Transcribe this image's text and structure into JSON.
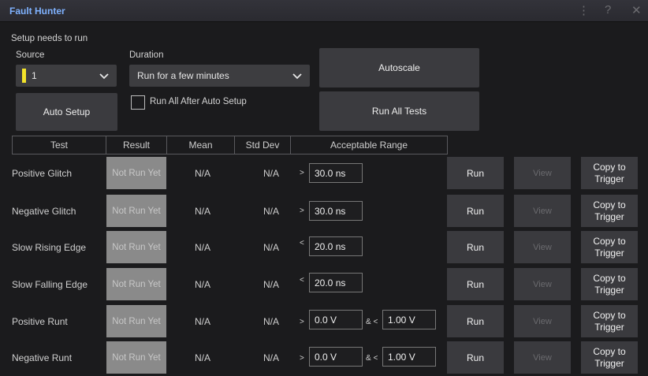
{
  "window": {
    "title": "Fault Hunter",
    "menu_icon": "vertical-ellipsis-icon",
    "help_icon": "question-mark-icon",
    "close_icon": "close-icon",
    "help_glyph": "?",
    "close_glyph": "✕",
    "menu_glyph": "⋮"
  },
  "setup": {
    "status": "Setup needs to run",
    "source_label": "Source",
    "source_value": "1",
    "source_color": "#f3e32a",
    "duration_label": "Duration",
    "duration_value": "Run for a few minutes",
    "autoscale_label": "Autoscale",
    "auto_setup_label": "Auto Setup",
    "run_all_after_label": "Run All After Auto Setup",
    "run_all_tests_label": "Run All Tests",
    "chevron": "⌄"
  },
  "table": {
    "headers": [
      "Test",
      "Result",
      "Mean",
      "Std Dev",
      "Acceptable Range"
    ],
    "run_label": "Run",
    "view_label": "View",
    "copy_label_1": "Copy to",
    "copy_label_2": "Trigger",
    "rows": [
      {
        "test": "Positive Glitch",
        "result": "Not Run Yet",
        "mean": "N/A",
        "std": "N/A",
        "op": ">",
        "value": "30.0 ns",
        "op2": "",
        "value2": ""
      },
      {
        "test": "Negative Glitch",
        "result": "Not Run Yet",
        "mean": "N/A",
        "std": "N/A",
        "op": ">",
        "value": "30.0 ns",
        "op2": "",
        "value2": ""
      },
      {
        "test": "Slow Rising Edge",
        "result": "Not Run Yet",
        "mean": "N/A",
        "std": "N/A",
        "op": "<",
        "value": "20.0 ns",
        "op2": "",
        "value2": ""
      },
      {
        "test": "Slow Falling Edge",
        "result": "Not Run Yet",
        "mean": "N/A",
        "std": "N/A",
        "op": "<",
        "value": "20.0 ns",
        "op2": "",
        "value2": ""
      },
      {
        "test": "Positive Runt",
        "result": "Not Run Yet",
        "mean": "N/A",
        "std": "N/A",
        "op": ">",
        "value": "0.0 V",
        "op2": "& <",
        "value2": "1.00 V"
      },
      {
        "test": "Negative Runt",
        "result": "Not Run Yet",
        "mean": "N/A",
        "std": "N/A",
        "op": ">",
        "value": "0.0 V",
        "op2": "& <",
        "value2": "1.00 V"
      }
    ]
  }
}
